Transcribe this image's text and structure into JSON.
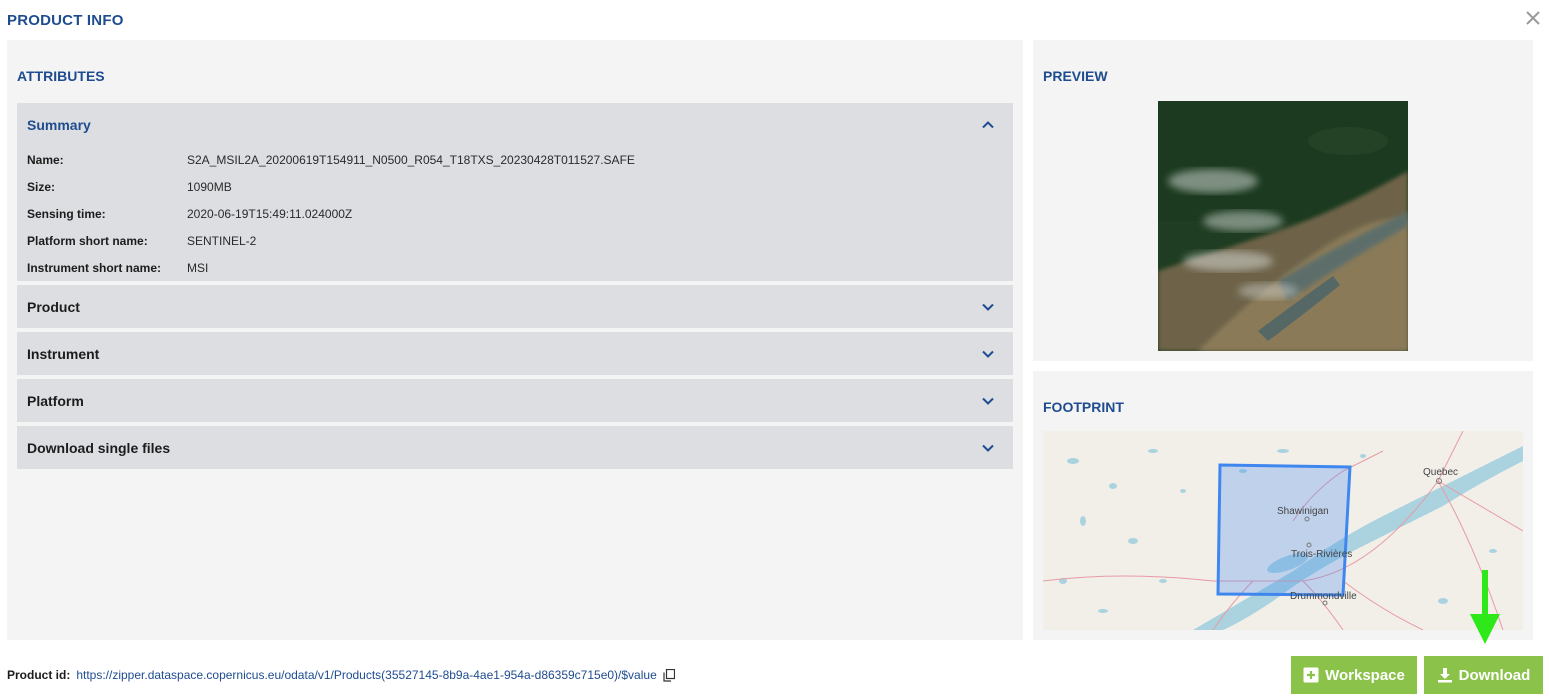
{
  "dialog": {
    "title": "PRODUCT INFO",
    "close_icon": "close-icon"
  },
  "attributes": {
    "title": "ATTRIBUTES",
    "summary": {
      "label": "Summary",
      "expanded": true,
      "rows": [
        {
          "key": "Name:",
          "value": "S2A_MSIL2A_20200619T154911_N0500_R054_T18TXS_20230428T011527.SAFE"
        },
        {
          "key": "Size:",
          "value": "1090MB"
        },
        {
          "key": "Sensing time:",
          "value": "2020-06-19T15:49:11.024000Z"
        },
        {
          "key": "Platform short name:",
          "value": "SENTINEL-2"
        },
        {
          "key": "Instrument short name:",
          "value": "MSI"
        }
      ]
    },
    "sections": [
      {
        "label": "Product",
        "expanded": false
      },
      {
        "label": "Instrument",
        "expanded": false
      },
      {
        "label": "Platform",
        "expanded": false
      },
      {
        "label": "Download single files",
        "expanded": false
      }
    ]
  },
  "preview": {
    "title": "PREVIEW"
  },
  "footprint": {
    "title": "FOOTPRINT",
    "map_labels": {
      "quebec": "Quebec",
      "shawinigan": "Shawinigan",
      "trois_rivieres": "Trois-Rivières",
      "drummondville": "Drummondville"
    }
  },
  "product_id": {
    "label": "Product id:",
    "value": "https://zipper.dataspace.copernicus.eu/odata/v1/Products(35527145-8b9a-4ae1-954a-d86359c715e0)/$value"
  },
  "actions": {
    "workspace_label": "Workspace",
    "download_label": "Download"
  },
  "colors": {
    "accent": "#1e4c8f",
    "button": "#8bc34a",
    "arrow": "#2ee81a",
    "footprint": "#3f87ef"
  }
}
